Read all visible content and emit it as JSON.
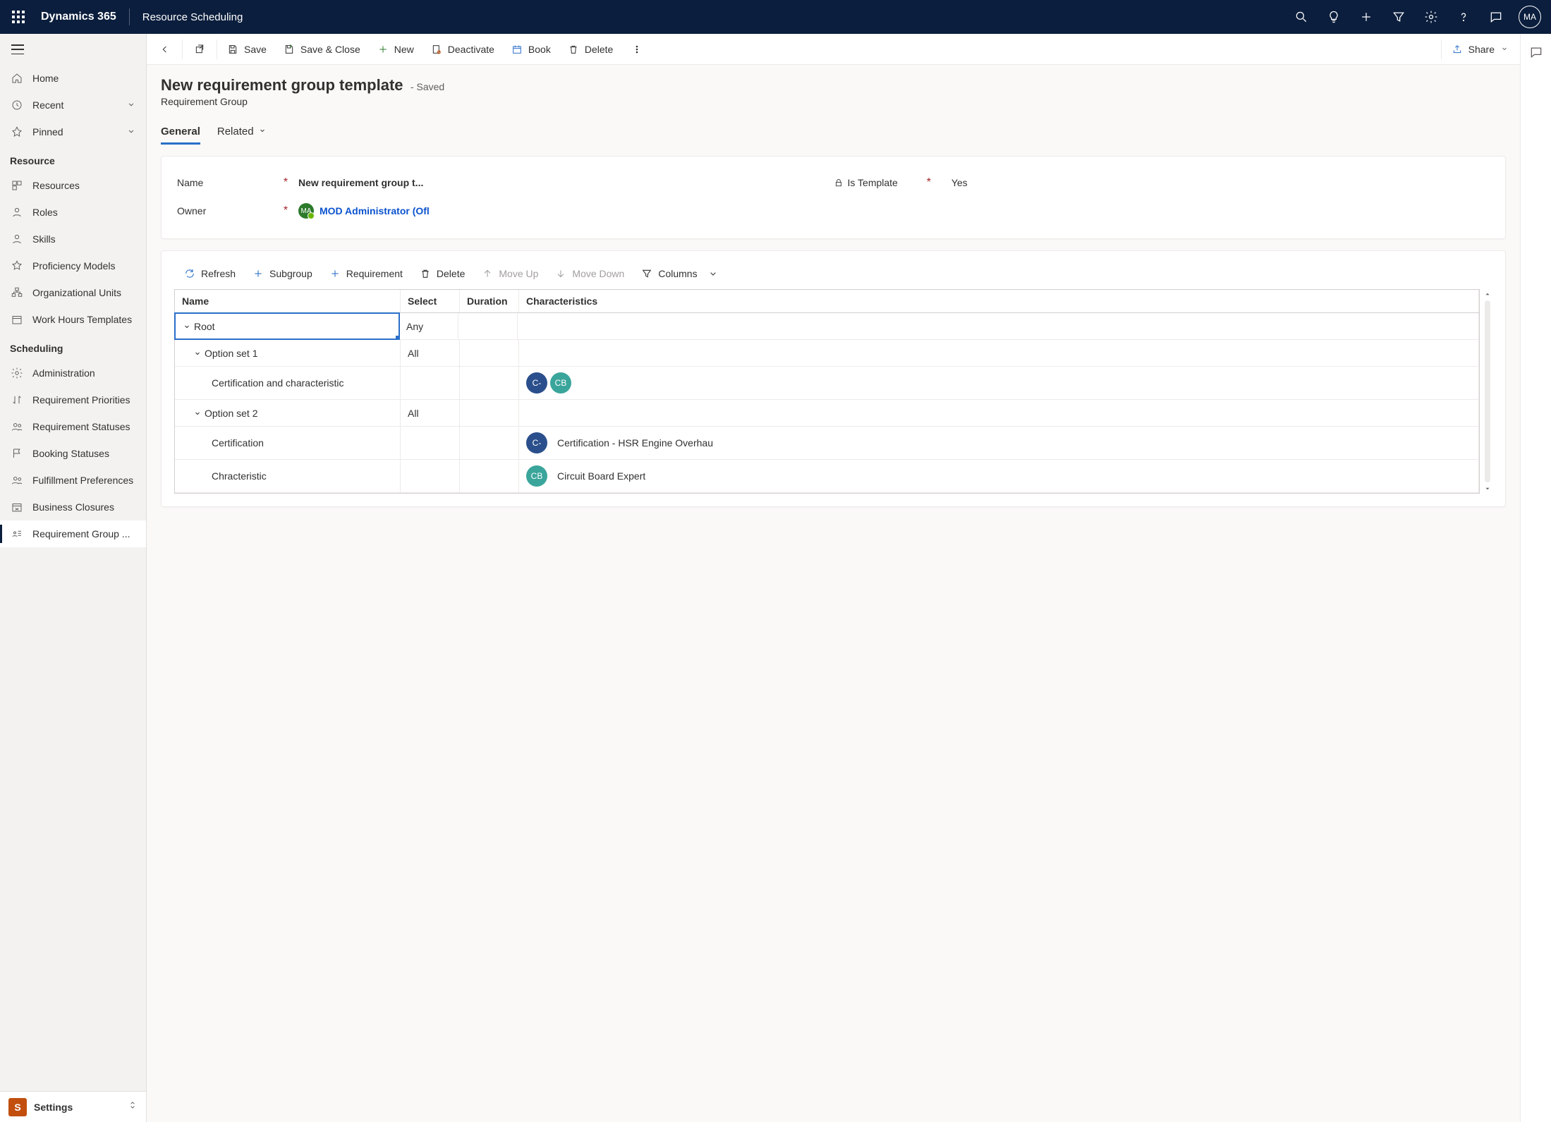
{
  "topbar": {
    "brand": "Dynamics 365",
    "app": "Resource Scheduling",
    "avatar_initials": "MA"
  },
  "leftnav": {
    "primary": [
      {
        "label": "Home"
      },
      {
        "label": "Recent",
        "caret": true
      },
      {
        "label": "Pinned",
        "caret": true
      }
    ],
    "groups": [
      {
        "title": "Resource",
        "items": [
          {
            "label": "Resources"
          },
          {
            "label": "Roles"
          },
          {
            "label": "Skills"
          },
          {
            "label": "Proficiency Models"
          },
          {
            "label": "Organizational Units"
          },
          {
            "label": "Work Hours Templates"
          }
        ]
      },
      {
        "title": "Scheduling",
        "items": [
          {
            "label": "Administration"
          },
          {
            "label": "Requirement Priorities"
          },
          {
            "label": "Requirement Statuses"
          },
          {
            "label": "Booking Statuses"
          },
          {
            "label": "Fulfillment Preferences"
          },
          {
            "label": "Business Closures"
          },
          {
            "label": "Requirement Group ...",
            "selected": true
          }
        ]
      }
    ],
    "area": {
      "badge": "S",
      "label": "Settings"
    }
  },
  "commandbar": {
    "save": "Save",
    "save_close": "Save & Close",
    "new": "New",
    "deactivate": "Deactivate",
    "book": "Book",
    "delete": "Delete",
    "share": "Share"
  },
  "page": {
    "title": "New requirement group template",
    "status": "- Saved",
    "subtitle": "Requirement Group",
    "tabs": {
      "general": "General",
      "related": "Related"
    }
  },
  "form": {
    "name_label": "Name",
    "name_value": "New requirement group t...",
    "is_template_label": "Is Template",
    "is_template_value": "Yes",
    "owner_label": "Owner",
    "owner_initials": "MA",
    "owner_value": "MOD Administrator (Ofl"
  },
  "grid_toolbar": {
    "refresh": "Refresh",
    "subgroup": "Subgroup",
    "requirement": "Requirement",
    "delete": "Delete",
    "move_up": "Move Up",
    "move_down": "Move Down",
    "columns": "Columns"
  },
  "grid": {
    "headers": {
      "name": "Name",
      "select": "Select",
      "duration": "Duration",
      "characteristics": "Characteristics"
    },
    "rows": [
      {
        "name": "Root",
        "indent": 0,
        "expand": true,
        "select": "Any",
        "selected": true,
        "chips": [],
        "char_text": ""
      },
      {
        "name": "Option set 1",
        "indent": 1,
        "expand": true,
        "select": "All",
        "chips": [],
        "char_text": ""
      },
      {
        "name": "Certification and characteristic",
        "indent": 2,
        "expand": false,
        "select": "",
        "chips": [
          {
            "t": "C-",
            "c": "blue"
          },
          {
            "t": "CB",
            "c": "teal"
          }
        ],
        "char_text": ""
      },
      {
        "name": "Option set 2",
        "indent": 1,
        "expand": true,
        "select": "All",
        "chips": [],
        "char_text": ""
      },
      {
        "name": "Certification",
        "indent": 2,
        "expand": false,
        "select": "",
        "chips": [
          {
            "t": "C-",
            "c": "blue"
          }
        ],
        "char_text": "Certification - HSR Engine Overhau"
      },
      {
        "name": "Chracteristic",
        "indent": 2,
        "expand": false,
        "select": "",
        "chips": [
          {
            "t": "CB",
            "c": "teal"
          }
        ],
        "char_text": "Circuit Board Expert"
      }
    ]
  }
}
